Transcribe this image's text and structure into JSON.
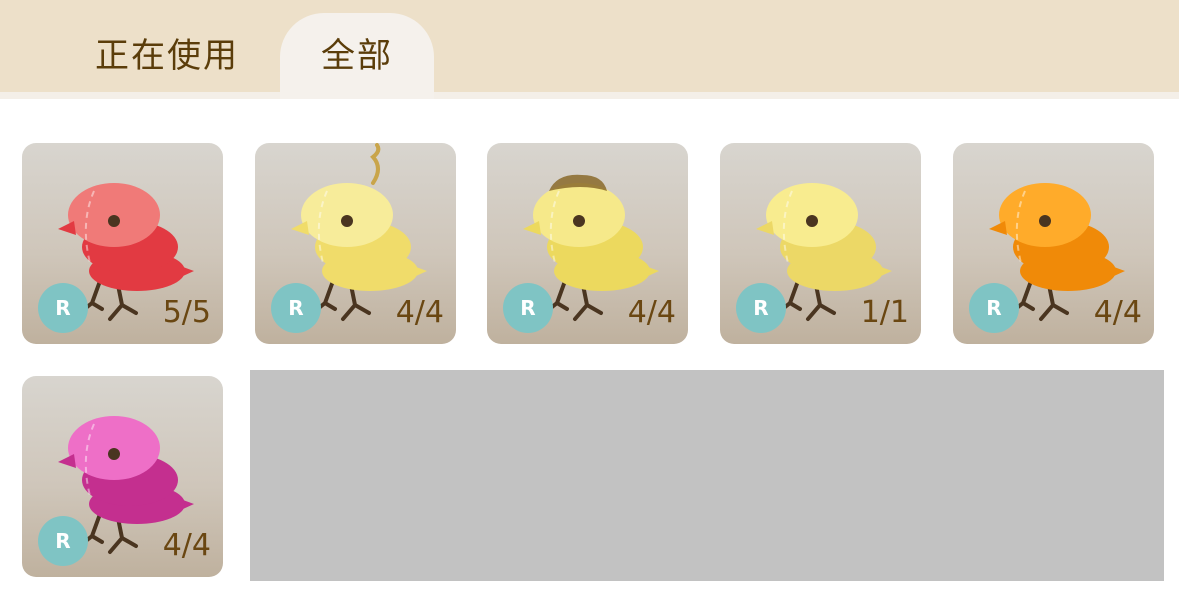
{
  "tabs": [
    {
      "label": "正在使用",
      "active": false
    },
    {
      "label": "全部",
      "active": true
    }
  ],
  "items": [
    {
      "rank": "R",
      "count": "5/5",
      "color_light": "#f07a78",
      "color_dark": "#e23a42",
      "crest": "none"
    },
    {
      "rank": "R",
      "count": "4/4",
      "color_light": "#f7ec9a",
      "color_dark": "#f0dc6a",
      "crest": "curl"
    },
    {
      "rank": "R",
      "count": "4/4",
      "color_light": "#f6e98a",
      "color_dark": "#ecd95e",
      "crest": "fuzz"
    },
    {
      "rank": "R",
      "count": "1/1",
      "color_light": "#f8ec8f",
      "color_dark": "#ecd866",
      "crest": "none"
    },
    {
      "rank": "R",
      "count": "4/4",
      "color_light": "#ffab2a",
      "color_dark": "#f08a08",
      "crest": "none"
    },
    {
      "rank": "R",
      "count": "4/4",
      "color_light": "#ee6fc7",
      "color_dark": "#c42f8f",
      "crest": "none"
    }
  ],
  "colors": {
    "tabbar_bg": "#ede0c9",
    "active_tab_bg": "#f5f1ec",
    "badge": "#7fc4c4",
    "count_text": "#6a4712",
    "placeholder": "#c2c2c2"
  }
}
